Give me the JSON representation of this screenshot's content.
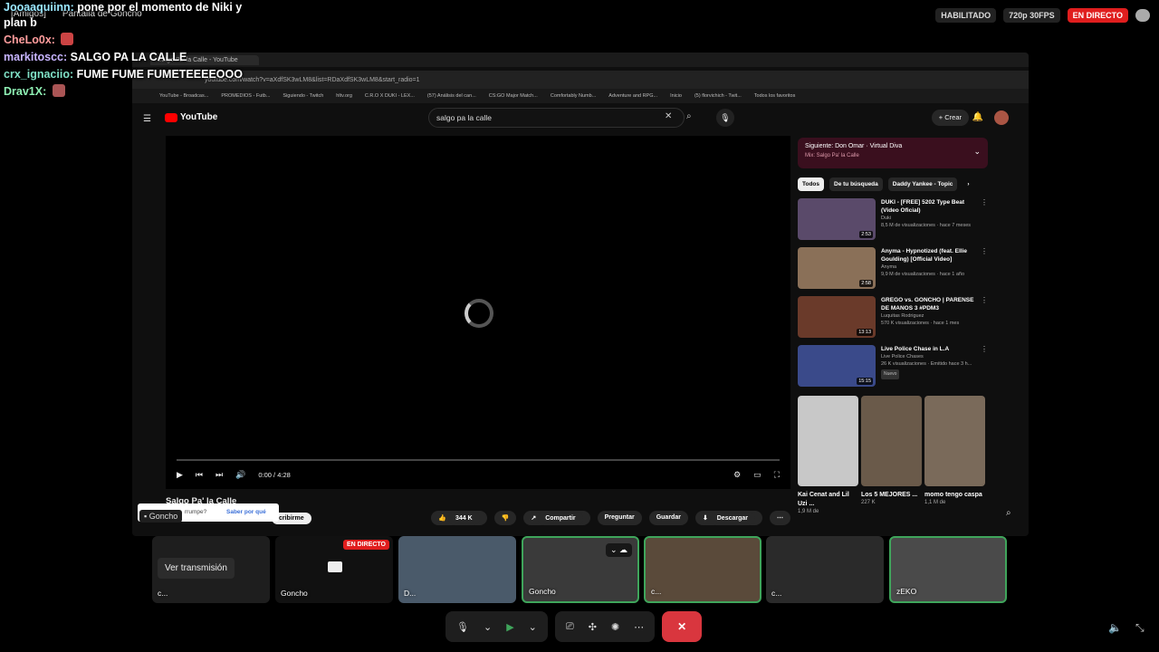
{
  "stream": {
    "chat": [
      {
        "user": "Jooaaquiinn:",
        "text": "pone por el momento de Niki y plan b",
        "color": "#9be8ff"
      },
      {
        "user": "CheLo0x:",
        "text": "",
        "color": "#ff9d9d"
      },
      {
        "user": "markitoscc:",
        "text": "SALGO PA LA CALLE",
        "color": "#c8b5ff"
      },
      {
        "user": "crx_ignaciio:",
        "text": "FUME FUME FUMETEEEEOOO",
        "color": "#7fe0c6"
      },
      {
        "user": "Drav1X:",
        "text": "",
        "color": "#8ff0b4"
      }
    ],
    "server_label": "[Amigos]",
    "screen_label": "Pantalla de Goncho",
    "status": {
      "enabled": "HABILITADO",
      "quality": "720p 30FPS",
      "live": "EN DIRECTO"
    }
  },
  "browser": {
    "tab_title": "Salgo Pa' la Calle - YouTube",
    "url": "youtube.com/watch?v=aXdfSK3wLM8&list=RDaXdfSK3wLM8&start_radio=1",
    "bookmarks": [
      "YouTube - Broadcas...",
      "PROMEDIOS - Futb...",
      "Siguiendo - Twitch",
      "hltv.org",
      "C.R.O X DUKI - LEX...",
      "(57) Análisis del can...",
      "CS:GO Major Match...",
      "Comfortably Numb...",
      "Adventure and RPG...",
      "Inicio",
      "(5) florvichich - Twit...",
      "Todos los favoritos"
    ]
  },
  "youtube": {
    "logo": "YouTube",
    "search_value": "salgo pa la calle",
    "create": "Crear",
    "player": {
      "time": "0:00 / 4:28"
    },
    "video_title": "Salgo Pa' la Calle",
    "actions": {
      "likes": "344 K",
      "share": "Compartir",
      "ask": "Preguntar",
      "save": "Guardar",
      "download": "Descargar"
    },
    "next_up": {
      "title": "Siguiente: Don Omar · Virtual Diva",
      "sub": "Mix: Salgo Pa' la Calle"
    },
    "chips": [
      "Todos",
      "De tu búsqueda",
      "Daddy Yankee - Topic"
    ],
    "videos": [
      {
        "title": "DUKI - [FREE] 5202 Type Beat (Video Oficial)",
        "channel": "Duki",
        "meta": "8,5 M de visualizaciones · hace 7 meses",
        "duration": "2:53",
        "color": "#5a4a6a"
      },
      {
        "title": "Anyma - Hypnotized (feat. Ellie Goulding) [Official Video]",
        "channel": "Anyma",
        "meta": "9,9 M de visualizaciones · hace 1 año",
        "duration": "2:58",
        "color": "#8a7058"
      },
      {
        "title": "GREGO vs. GONCHO | PARENSE DE MANOS 3 #PDM3",
        "channel": "Luquitas Rodriguez",
        "meta": "570 K visualizaciones · hace 1 mes",
        "duration": "13:13",
        "color": "#6a3a2a"
      },
      {
        "title": "Live Police Chase in L.A",
        "channel": "Live Police Chases",
        "meta": "26 K visualizaciones · Emitido hace 3 h...",
        "duration": "15:15",
        "badge": "Nuevo",
        "color": "#3a4a8a"
      }
    ],
    "shorts": [
      {
        "title": "Kai Cenat and Lil Uzi ...",
        "views": "1,9 M de",
        "color": "#c8c8c8"
      },
      {
        "title": "Los 5 MEJORES ...",
        "views": "227 K",
        "color": "#6a5a4a"
      },
      {
        "title": "momo tengo caspa",
        "views": "1,1 M de",
        "color": "#7a6a5a"
      }
    ],
    "toast": {
      "question": "rrumpe?",
      "why": "Saber por qué"
    },
    "subscribe": "cribirme"
  },
  "call": {
    "presenter_tag": "Goncho",
    "watch_button": "Ver transmisión",
    "tiles": [
      {
        "label": "c...",
        "type": "watch"
      },
      {
        "label": "Goncho",
        "type": "screen",
        "live": "EN DIRECTO"
      },
      {
        "label": "D...",
        "color": "#4a5a6a"
      },
      {
        "label": "Goncho",
        "color": "#3a3a3a",
        "active": true
      },
      {
        "label": "c...",
        "color": "#5a4a3a",
        "active": true
      },
      {
        "label": "c...",
        "color": "#2a2a2a"
      },
      {
        "label": "zEKO",
        "color": "#4a4a4a",
        "active": true
      }
    ]
  }
}
